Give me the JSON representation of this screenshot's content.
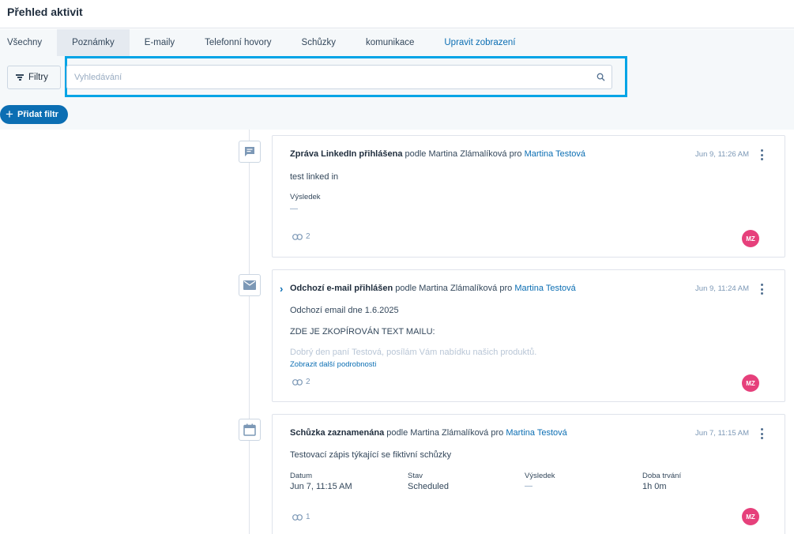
{
  "page": {
    "title": "Přehled aktivit"
  },
  "tabs": [
    {
      "label": "Všechny"
    },
    {
      "label": "Poznámky"
    },
    {
      "label": "E-maily"
    },
    {
      "label": "Telefonní hovory"
    },
    {
      "label": "Schůzky"
    },
    {
      "label": "komunikace"
    },
    {
      "label": "Upravit zobrazení"
    }
  ],
  "active_tab": "Poznámky",
  "filters": {
    "filter_button_label": "Filtry",
    "search_placeholder": "Vyhledávání",
    "add_filter_label": "Přidat filtr"
  },
  "activities": [
    {
      "type_icon": "chat-message-icon",
      "title": "Zpráva LinkedIn přihlášena",
      "by_prefix": "podle",
      "author": "Martina Zlámalíková",
      "for_prefix": "pro",
      "contact": "Martina Testová",
      "timestamp": "Jun 9, 11:26 AM",
      "body": "test linked in",
      "result_label": "Výsledek",
      "result_value": "—",
      "associations": "2",
      "avatar": "MZ"
    },
    {
      "type_icon": "envelope-icon",
      "title": "Odchozí e-mail přihlášen",
      "by_prefix": "podle",
      "author": "Martina Zlámalíková",
      "for_prefix": "pro",
      "contact": "Martina Testová",
      "timestamp": "Jun 9, 11:24 AM",
      "body_line1": "Odchozí email dne 1.6.2025",
      "body_line2": "ZDE JE ZKOPÍROVÁN TEXT MAILU:",
      "body_faded": "Dobrý den paní Testová, posílám Vám nabídku našich produktů.",
      "more_link": "Zobrazit další podrobnosti",
      "associations": "2",
      "avatar": "MZ"
    },
    {
      "type_icon": "calendar-icon",
      "title": "Schůzka zaznamenána",
      "by_prefix": "podle",
      "author": "Martina Zlámalíková",
      "for_prefix": "pro",
      "contact": "Martina Testová",
      "timestamp": "Jun 7, 11:15 AM",
      "body": "Testovací zápis týkající se fiktivní schůzky",
      "fields": [
        {
          "label": "Datum",
          "value": "Jun 7, 11:15 AM"
        },
        {
          "label": "Stav",
          "value": "Scheduled"
        },
        {
          "label": "Výsledek",
          "value": "—"
        },
        {
          "label": "Doba trvání",
          "value": "1h 0m"
        }
      ],
      "associations": "1",
      "avatar": "MZ"
    }
  ],
  "colors": {
    "accent": "#0b6eb3",
    "highlight": "#00a4e6",
    "avatar": "#e6407b",
    "filter_bg": "#f5f8fa"
  }
}
